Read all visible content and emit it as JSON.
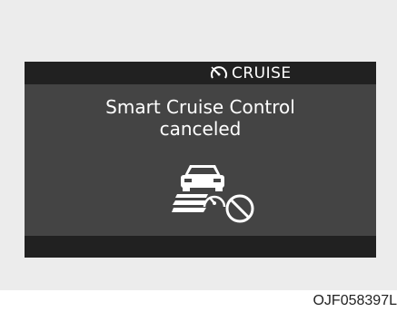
{
  "display": {
    "mode_label": "CRUISE",
    "mode_icon": "cruise-gauge-icon",
    "message_line1": "Smart Cruise Control",
    "message_line2": "canceled",
    "status_icon": "cruise-canceled-icon"
  },
  "figure_code": "OJF058397L",
  "colors": {
    "screen": "#444444",
    "bars": "#212121",
    "text": "#ffffff",
    "background": "#ececec"
  }
}
